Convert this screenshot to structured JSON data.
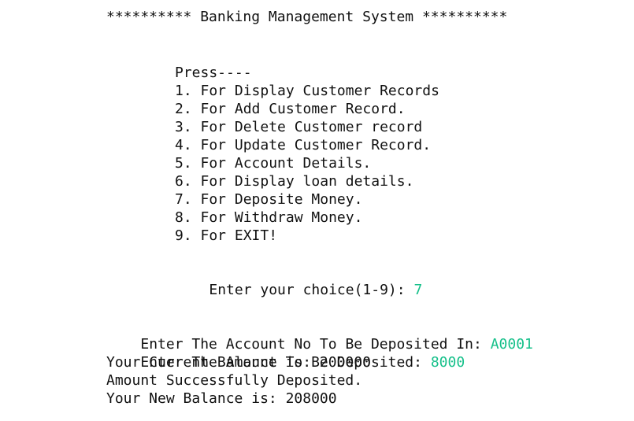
{
  "title": "********** Banking Management System **********",
  "menu": {
    "header": "Press----",
    "items": [
      "1. For Display Customer Records",
      "2. For Add Customer Record.",
      "3. For Delete Customer record",
      "4. For Update Customer Record.",
      "5. For Account Details.",
      "6. For Display loan details.",
      "7. For Deposite Money.",
      "8. For Withdraw Money.",
      "9. For EXIT!"
    ],
    "prompt": "Enter your choice(1-9): ",
    "choice": "7"
  },
  "deposit": {
    "account_prompt": "Enter The Account No To Be Deposited In: ",
    "account_value": "A0001",
    "amount_prompt": "Enter The Amount To Be Deposited: ",
    "amount_value": "8000",
    "current_balance": "Your Current Balance is: 200000",
    "success": "Amount Successfully Deposited.",
    "new_balance": "Your New Balance is: 208000"
  },
  "colors": {
    "text": "#111111",
    "input": "#16c08a",
    "background": "#ffffff"
  }
}
